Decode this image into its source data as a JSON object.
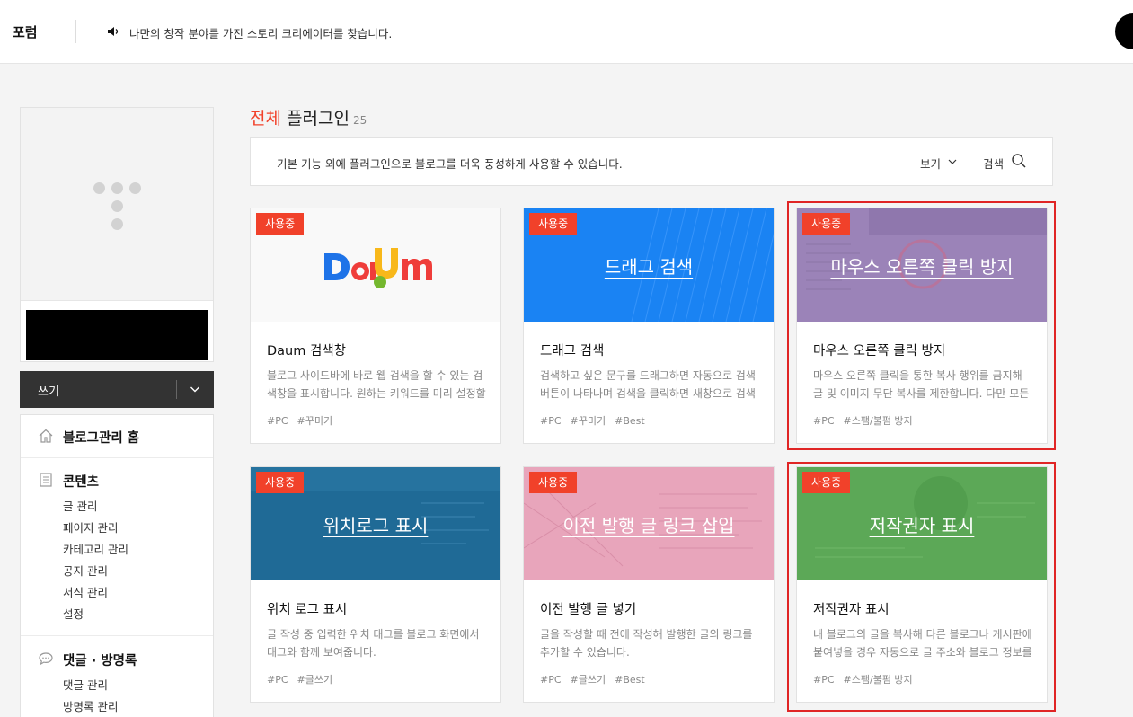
{
  "topbar": {
    "forum_label": "포럼",
    "notice": "나만의 창작 분야를 가진 스토리 크리에이터를 찾습니다."
  },
  "sidebar": {
    "write_label": "쓰기",
    "sections": [
      {
        "title": "블로그관리 홈",
        "items": []
      },
      {
        "title": "콘텐츠",
        "items": [
          "글 관리",
          "페이지 관리",
          "카테고리 관리",
          "공지 관리",
          "서식 관리",
          "설정"
        ]
      },
      {
        "title": "댓글 · 방명록",
        "items": [
          "댓글 관리",
          "방명록 관리"
        ]
      }
    ]
  },
  "main": {
    "heading_accent": "전체",
    "heading_rest": "플러그인",
    "heading_count": "25",
    "description": "기본 기능 외에 플러그인으로 블로그를 더욱 풍성하게 사용할 수 있습니다.",
    "view_label": "보기",
    "search_label": "검색"
  },
  "plugins": [
    {
      "badge": "사용중",
      "banner_text": "",
      "banner_color": "#f9f9f9",
      "title": "Daum 검색창",
      "desc": "블로그 사이드바에 바로 웹 검색을 할 수 있는 검색창을 표시합니다. 원하는 키워드를 미리 설정할 수 있습니다.",
      "tags": [
        "#PC",
        "#꾸미기"
      ]
    },
    {
      "badge": "사용중",
      "banner_text": "드래그 검색",
      "banner_color": "#1a83f3",
      "title": "드래그 검색",
      "desc": "검색하고 싶은 문구를 드래그하면 자동으로 검색 버튼이 나타나며 검색을 클릭하면 새창으로 검색결과를 보여줍니다.",
      "tags": [
        "#PC",
        "#꾸미기",
        "#Best"
      ]
    },
    {
      "badge": "사용중",
      "banner_text": "마우스 오른쪽 클릭 방지",
      "banner_color": "#9b83b8",
      "title": "마우스 오른쪽 클릭 방지",
      "desc": "마우스 오른쪽 클릭을 통한 복사 행위를 금지해 글 및 이미지 무단 복사를 제한합니다. 다만 모든 경우를 막을 수는 없습니다.",
      "tags": [
        "#PC",
        "#스팸/불펌 방지"
      ]
    },
    {
      "badge": "사용중",
      "banner_text": "위치로그 표시",
      "banner_color": "#1f6a96",
      "title": "위치 로그 표시",
      "desc": "글 작성 중 입력한 위치 태그를 블로그 화면에서 태그와 함께 보여줍니다.",
      "tags": [
        "#PC",
        "#글쓰기"
      ]
    },
    {
      "badge": "사용중",
      "banner_text": "이전 발행 글 링크 삽입",
      "banner_color": "#e8a5bb",
      "title": "이전 발행 글 넣기",
      "desc": "글을 작성할 때 전에 작성해 발행한 글의 링크를 추가할 수 있습니다.",
      "tags": [
        "#PC",
        "#글쓰기",
        "#Best"
      ]
    },
    {
      "badge": "사용중",
      "banner_text": "저작권자 표시",
      "banner_color": "#5ca857",
      "title": "저작권자 표시",
      "desc": "내 블로그의 글을 복사해 다른 블로그나 게시판에 붙여넣을 경우 자동으로 글 주소와 블로그 정보를 표시합니다.",
      "tags": [
        "#PC",
        "#스팸/불펌 방지"
      ]
    }
  ]
}
